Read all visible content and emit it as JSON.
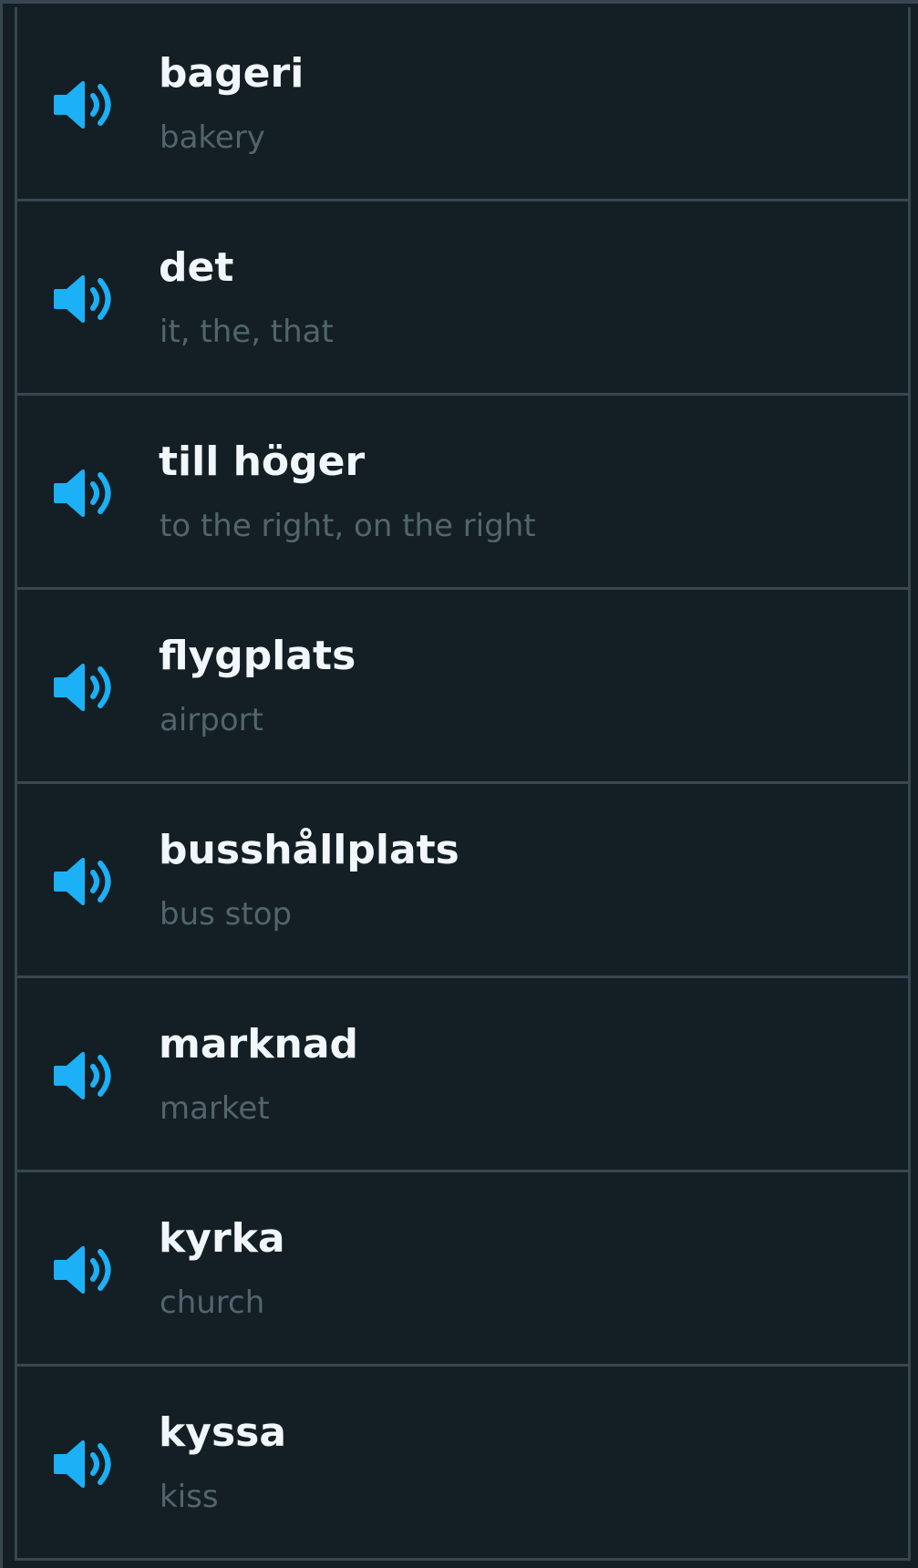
{
  "theme": {
    "background": "#131f24",
    "border": "#37464f",
    "word_color": "#f1f7fb",
    "meaning_color": "#52656d",
    "speaker_icon_color": "#1cb0f6"
  },
  "words": [
    {
      "word": "bageri",
      "meaning": "bakery",
      "icon": "speaker-icon"
    },
    {
      "word": "det",
      "meaning": "it, the, that",
      "icon": "speaker-icon"
    },
    {
      "word": "till höger",
      "meaning": "to the right, on the right",
      "icon": "speaker-icon"
    },
    {
      "word": "flygplats",
      "meaning": "airport",
      "icon": "speaker-icon"
    },
    {
      "word": "busshållplats",
      "meaning": "bus stop",
      "icon": "speaker-icon"
    },
    {
      "word": "marknad",
      "meaning": "market",
      "icon": "speaker-icon"
    },
    {
      "word": "kyrka",
      "meaning": "church",
      "icon": "speaker-icon"
    },
    {
      "word": "kyssa",
      "meaning": "kiss",
      "icon": "speaker-icon"
    }
  ]
}
